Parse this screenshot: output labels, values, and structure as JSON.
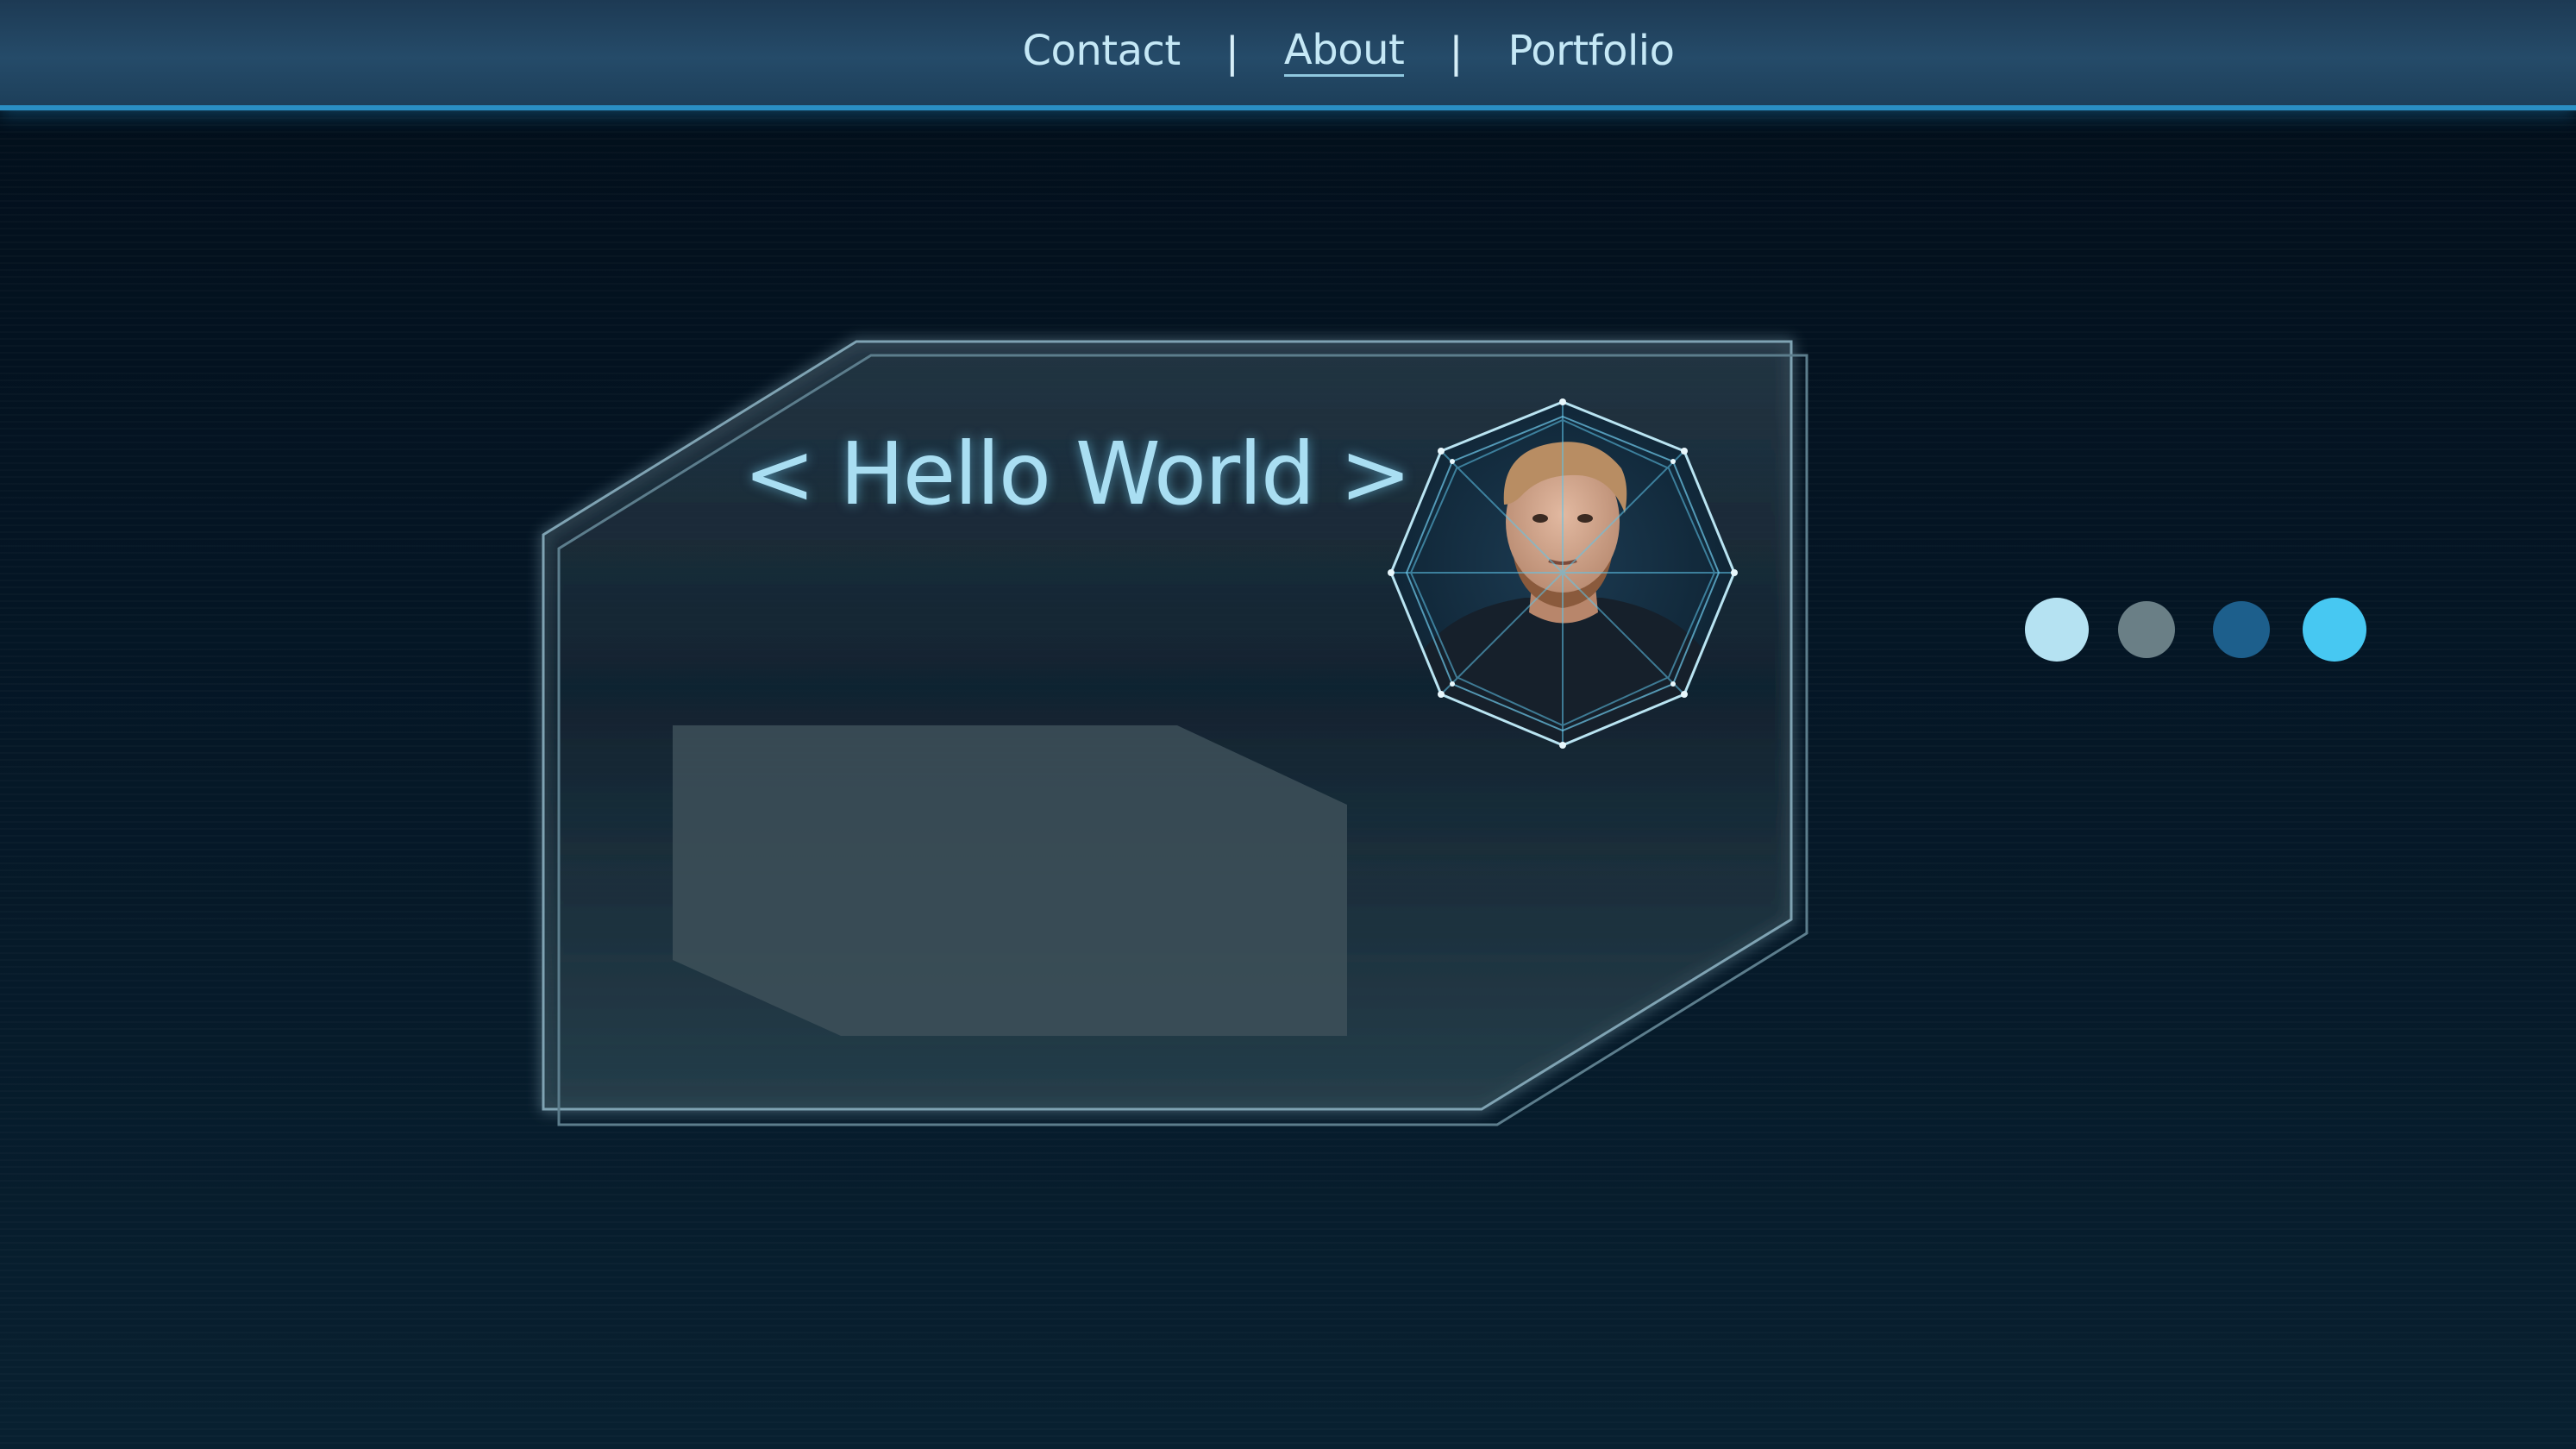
{
  "nav": {
    "items": [
      {
        "label": "Contact"
      },
      {
        "label": "About",
        "active": true
      },
      {
        "label": "Portfolio"
      }
    ],
    "separator": "|"
  },
  "card": {
    "heading": "< Hello World >"
  },
  "avatar": {
    "icon": "profile-photo"
  },
  "dots": {
    "colors": [
      "#b5e2f2",
      "#6a7f86",
      "#1d5f8c",
      "#47c8f2"
    ]
  },
  "colors": {
    "accent": "#2a8fc4",
    "text": "#c5e8f6",
    "background": "#05131f"
  }
}
